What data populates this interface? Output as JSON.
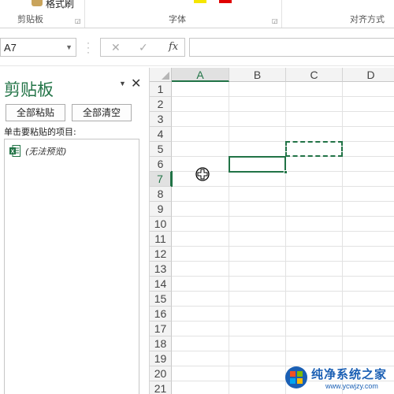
{
  "ribbon": {
    "format_painter_label": "格式刷",
    "groups": [
      {
        "label": "剪贴板"
      },
      {
        "label": "字体"
      },
      {
        "label": "对齐方式"
      }
    ],
    "swatch_colors": [
      "#f5e600",
      "#e00000"
    ]
  },
  "formula_bar": {
    "name_box_value": "A7",
    "cancel_icon": "✕",
    "enter_icon": "✓",
    "fx_label": "fx",
    "formula_value": ""
  },
  "clipboard_pane": {
    "title": "剪贴板",
    "paste_all_label": "全部粘贴",
    "clear_all_label": "全部清空",
    "hint": "单击要粘贴的项目:",
    "items": [
      {
        "icon": "excel-icon",
        "text": "(无法预览)"
      }
    ]
  },
  "sheet": {
    "columns": [
      "A",
      "B",
      "C",
      "D"
    ],
    "rows": [
      "1",
      "2",
      "3",
      "4",
      "5",
      "6",
      "7",
      "8",
      "9",
      "10",
      "11",
      "12",
      "13",
      "14",
      "15",
      "16",
      "17",
      "18",
      "19",
      "20",
      "21"
    ],
    "active_cell": "A7",
    "copy_marquee_cell": "C5",
    "selected_range_cell": "B6"
  },
  "watermark": {
    "title": "纯净系统之家",
    "url": "www.ycwjzy.com"
  },
  "colors": {
    "accent": "#217346",
    "watermark": "#1a5fb4"
  }
}
